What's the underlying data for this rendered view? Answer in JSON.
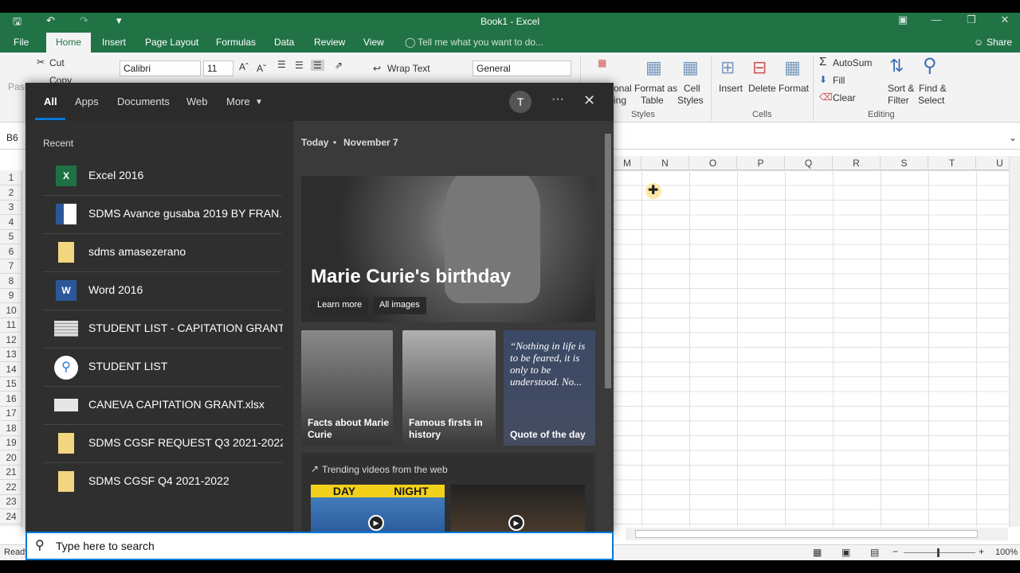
{
  "window": {
    "title": "Book1 - Excel"
  },
  "quick_access": {
    "save_icon": "save-icon",
    "undo_icon": "undo-icon",
    "redo_icon": "redo-icon"
  },
  "tabs": [
    "File",
    "Home",
    "Insert",
    "Page Layout",
    "Formulas",
    "Data",
    "Review",
    "View"
  ],
  "tell_me": "Tell me what you want to do...",
  "share": "Share",
  "ribbon": {
    "cut": "Cut",
    "copy": "Copy",
    "paste": "Paste",
    "font_name": "Calibri",
    "font_size": "11",
    "wrap_text": "Wrap Text",
    "number_format": "General",
    "format_table": "Format as",
    "format_table2": "Table",
    "cond_fmt1": "onal",
    "cond_fmt2": "ing",
    "cell_styles1": "Cell",
    "cell_styles2": "Styles",
    "insert": "Insert",
    "delete": "Delete",
    "format": "Format",
    "autosum": "AutoSum",
    "fill": "Fill",
    "clear": "Clear",
    "sort1": "Sort &",
    "sort2": "Filter",
    "find1": "Find &",
    "find2": "Select",
    "group_styles": "Styles",
    "group_cells": "Cells",
    "group_editing": "Editing"
  },
  "name_box": "B6",
  "columns": [
    "M",
    "N",
    "O",
    "P",
    "Q",
    "R",
    "S",
    "T",
    "U"
  ],
  "rows": [
    "1",
    "2",
    "3",
    "4",
    "5",
    "6",
    "7",
    "8",
    "9",
    "10",
    "11",
    "12",
    "13",
    "14",
    "15",
    "16",
    "17",
    "18",
    "19",
    "20",
    "21",
    "22",
    "23",
    "24"
  ],
  "status": {
    "ready": "Ready",
    "zoom": "100%"
  },
  "search_panel": {
    "tabs": [
      "All",
      "Apps",
      "Documents",
      "Web",
      "More"
    ],
    "avatar": "T",
    "recent_label": "Recent",
    "recent": [
      {
        "label": "Excel 2016",
        "icon": "excel-icon"
      },
      {
        "label": "SDMS Avance gusaba 2019 BY FRAN...",
        "icon": "word-doc-icon"
      },
      {
        "label": "sdms amasezerano",
        "icon": "folder-icon"
      },
      {
        "label": "Word 2016",
        "icon": "word-icon"
      },
      {
        "label": "STUDENT LIST - CAPITATION GRANT ...",
        "icon": "spreadsheet-icon"
      },
      {
        "label": "STUDENT LIST",
        "icon": "search-icon"
      },
      {
        "label": "CANEVA CAPITATION GRANT.xlsx",
        "icon": "spreadsheet-icon"
      },
      {
        "label": "SDMS CGSF REQUEST Q3 2021-2022",
        "icon": "folder-icon"
      },
      {
        "label": "SDMS CGSF Q4 2021-2022",
        "icon": "folder-icon"
      }
    ],
    "today": "Today",
    "date": "November 7",
    "hero_title": "Marie Curie's birthday",
    "learn_more": "Learn more",
    "all_images": "All images",
    "card1": "Facts about Marie Curie",
    "card2": "Famous firsts in history",
    "quote": "“Nothing in life is to be feared, it is only to be understood. No...",
    "card3": "Quote of the day",
    "trending": "Trending videos from the web",
    "video_day": "DAY",
    "video_night": "NIGHT",
    "search_placeholder": "Type here to search"
  }
}
